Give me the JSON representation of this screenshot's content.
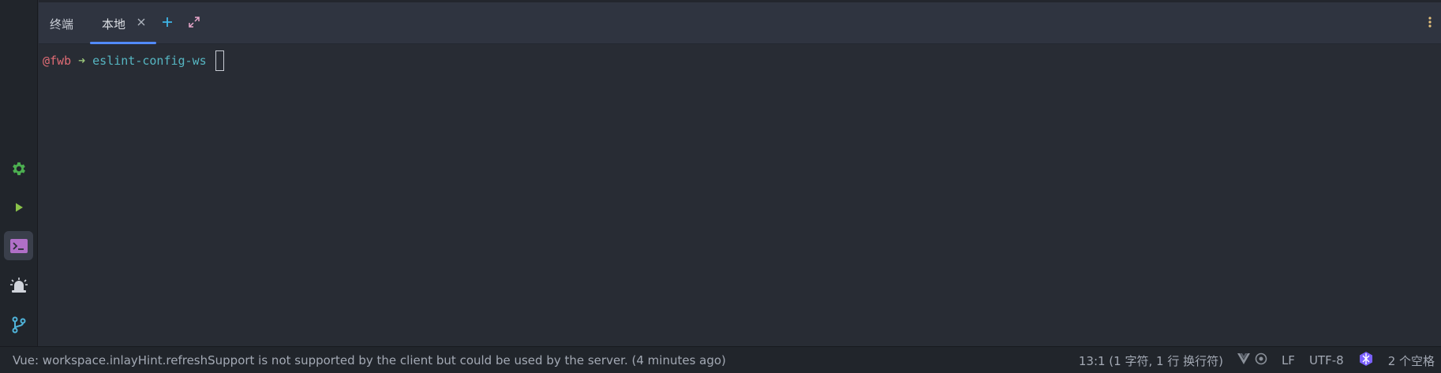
{
  "toolwindow": {
    "title": "终端",
    "tabs": [
      {
        "label": "本地",
        "active": true
      }
    ],
    "actions": {
      "add": "plus-icon",
      "maximize": "maximize-icon",
      "more": "more-vertical-icon"
    }
  },
  "sidebar": {
    "tools": [
      {
        "name": "settings",
        "icon": "gear-icon",
        "color": "#4caf50"
      },
      {
        "name": "run",
        "icon": "play-icon",
        "color": "#8bc34a"
      },
      {
        "name": "terminal",
        "icon": "terminal-icon",
        "color": "#c678dd",
        "active": true
      },
      {
        "name": "alarm",
        "icon": "alarm-icon",
        "color": "#d0d4db"
      },
      {
        "name": "git",
        "icon": "git-branch-icon",
        "color": "#4fb3d9"
      }
    ]
  },
  "terminal": {
    "prompt_user": "@fwb",
    "prompt_arrow": "➜",
    "prompt_dir": "eslint-config-ws"
  },
  "statusbar": {
    "message": "Vue: workspace.inlayHint.refreshSupport is not supported by the client but could be used by the server. (4 minutes ago)",
    "position": "13:1 (1 字符, 1 行 换行符)",
    "line_ending": "LF",
    "encoding": "UTF-8",
    "indent": "2 个空格"
  },
  "colors": {
    "accent": "#528bff",
    "prompt_user": "#e06c75",
    "prompt_arrow": "#98c379",
    "prompt_dir": "#56b6c2"
  }
}
